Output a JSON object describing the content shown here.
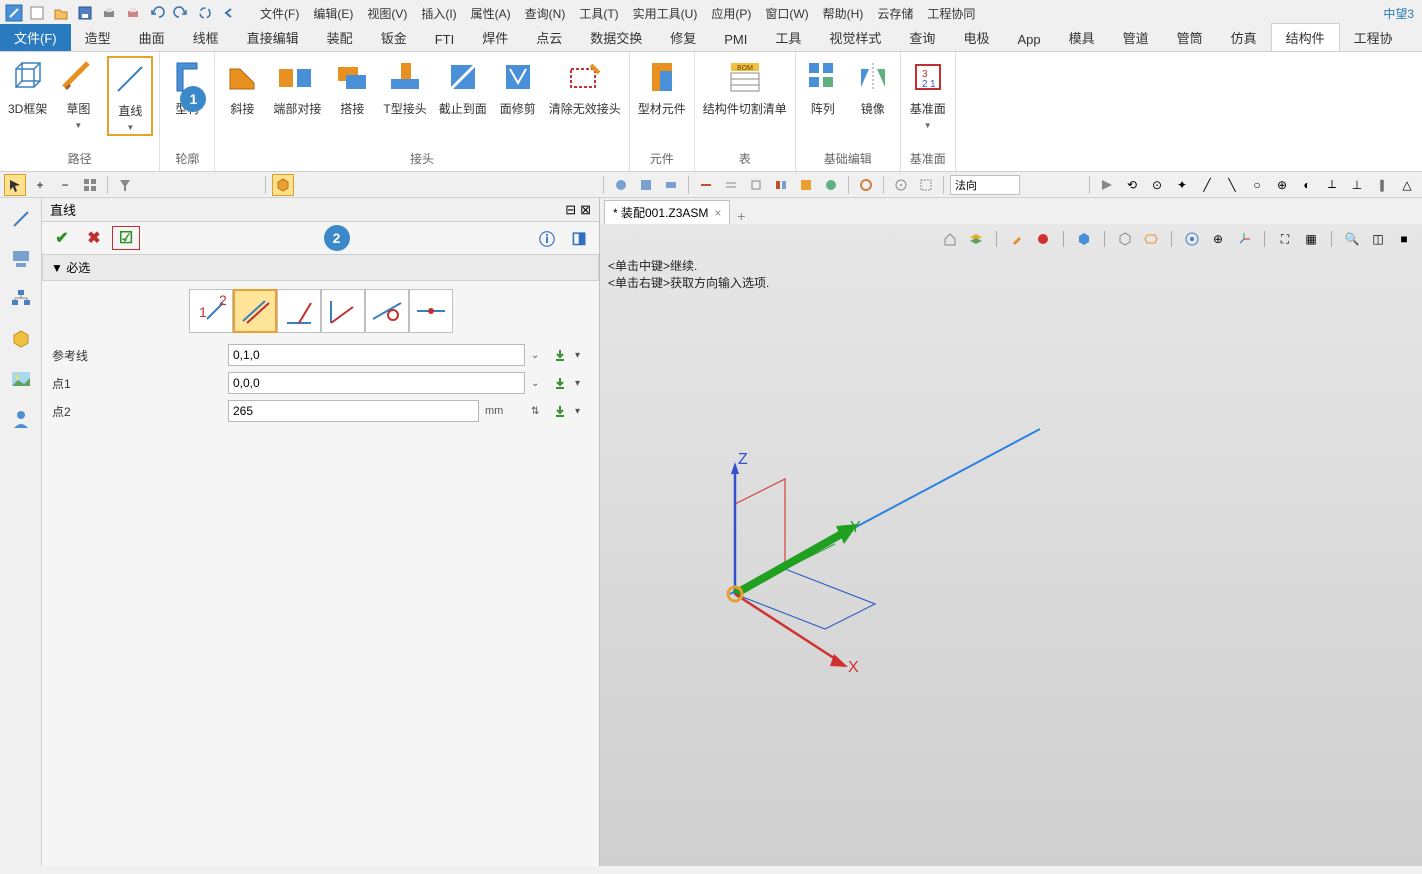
{
  "app_name": "中望3",
  "menu": {
    "items": [
      "文件(F)",
      "编辑(E)",
      "视图(V)",
      "插入(I)",
      "属性(A)",
      "查询(N)",
      "工具(T)",
      "实用工具(U)",
      "应用(P)",
      "窗口(W)",
      "帮助(H)",
      "云存储",
      "工程协同"
    ]
  },
  "ribbon_tabs": [
    "文件(F)",
    "造型",
    "曲面",
    "线框",
    "直接编辑",
    "装配",
    "钣金",
    "FTI",
    "焊件",
    "点云",
    "数据交换",
    "修复",
    "PMI",
    "工具",
    "视觉样式",
    "查询",
    "电极",
    "App",
    "模具",
    "管道",
    "管筒",
    "仿真",
    "结构件",
    "工程协"
  ],
  "ribbon_active_left": "文件(F)",
  "ribbon_active_right": "结构件",
  "ribbon_groups": {
    "path": {
      "label": "路径",
      "items": [
        "3D框架",
        "草图",
        "直线"
      ]
    },
    "profile": {
      "label": "轮廓",
      "items": [
        "型材"
      ]
    },
    "joint": {
      "label": "接头",
      "items": [
        "斜接",
        "端部对接",
        "搭接",
        "T型接头",
        "截止到面",
        "面修剪",
        "清除无效接头"
      ]
    },
    "element": {
      "label": "元件",
      "items": [
        "型材元件"
      ]
    },
    "table": {
      "label": "表",
      "items": [
        "结构件切割清单"
      ]
    },
    "basic_edit": {
      "label": "基础编辑",
      "items": [
        "阵列",
        "镜像"
      ]
    },
    "datum": {
      "label": "基准面",
      "items": [
        "基准面"
      ]
    }
  },
  "toolbar": {
    "direction_label": "法向"
  },
  "panel": {
    "title": "直线",
    "accordion": "必选",
    "params": {
      "ref_line": {
        "label": "参考线",
        "value": "0,1,0"
      },
      "pt1": {
        "label": "点1",
        "value": "0,0,0"
      },
      "pt2": {
        "label": "点2",
        "value": "265",
        "unit": "mm"
      }
    }
  },
  "doc_tab": {
    "name": "* 装配001.Z3ASM"
  },
  "hints": {
    "line1": "<单击中键>继续.",
    "line2": "<单击右键>获取方向输入选项."
  },
  "axes": {
    "x": "X",
    "y": "Y",
    "z": "Z"
  },
  "badges": {
    "one": "1",
    "two": "2"
  }
}
